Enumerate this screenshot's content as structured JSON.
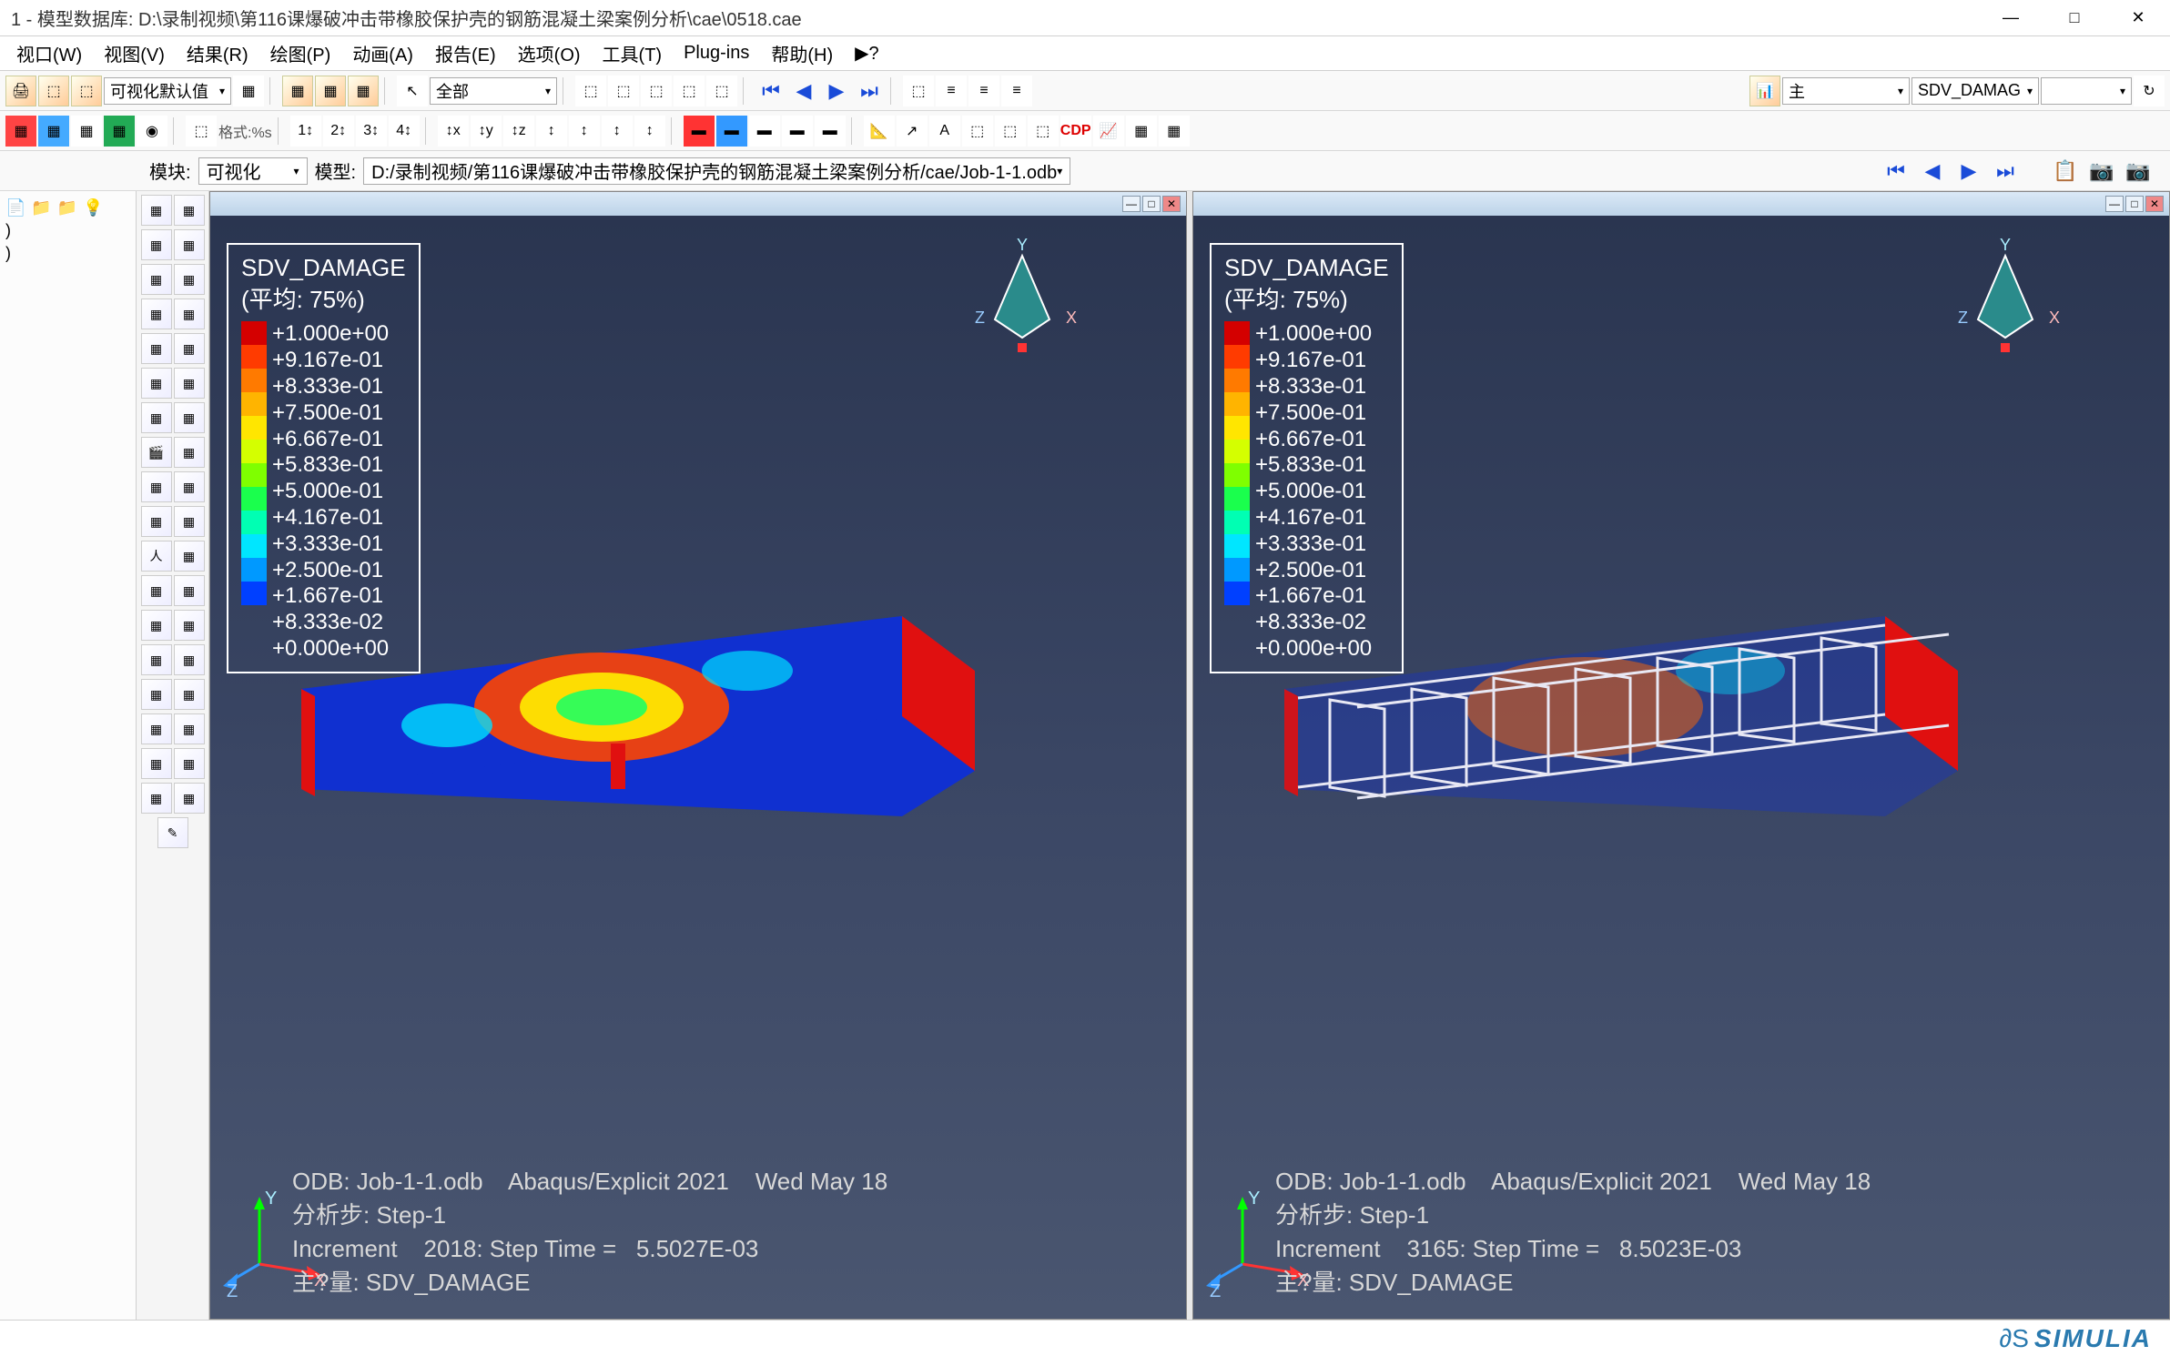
{
  "window": {
    "title": "1 - 模型数据库: D:\\录制视频\\第116课爆破冲击带橡胶保护壳的钢筋混凝土梁案例分析\\cae\\0518.cae"
  },
  "menus": [
    "视口(W)",
    "视图(V)",
    "结果(R)",
    "绘图(P)",
    "动画(A)",
    "报告(E)",
    "选项(O)",
    "工具(T)",
    "Plug-ins",
    "帮助(H)",
    "▶?"
  ],
  "toolbar1": {
    "combo_vis": "可视化默认值",
    "combo_all": "全部",
    "combo_primary": "主",
    "combo_field": "SDV_DAMAG",
    "format_label": "格式:%s"
  },
  "context": {
    "module_label": "模块:",
    "module_value": "可视化",
    "model_label": "模型:",
    "model_value": "D:/录制视频/第116课爆破冲击带橡胶保护壳的钢筋混凝土梁案例分析/cae/Job-1-1.odb"
  },
  "legend": {
    "title": "SDV_DAMAGE",
    "subtitle": "(平均: 75%)",
    "values": [
      "+1.000e+00",
      "+9.167e-01",
      "+8.333e-01",
      "+7.500e-01",
      "+6.667e-01",
      "+5.833e-01",
      "+5.000e-01",
      "+4.167e-01",
      "+3.333e-01",
      "+2.500e-01",
      "+1.667e-01",
      "+8.333e-02",
      "+0.000e+00"
    ],
    "colors": [
      "#d40000",
      "#ff3b00",
      "#ff7a00",
      "#ffb400",
      "#ffe600",
      "#d4ff00",
      "#7fff00",
      "#1aff4d",
      "#00ffb3",
      "#00e6ff",
      "#0099ff",
      "#0040ff"
    ]
  },
  "viewport_left": {
    "line1": "ODB: Job-1-1.odb    Abaqus/Explicit 2021    Wed May 18",
    "line2": "分析步: Step-1",
    "line3": "Increment    2018: Step Time =   5.5027E-03",
    "line4": "主?量: SDV_DAMAGE"
  },
  "viewport_right": {
    "line1": "ODB: Job-1-1.odb    Abaqus/Explicit 2021    Wed May 18",
    "line2": "分析步: Step-1",
    "line3": "Increment    3165: Step Time =   8.5023E-03",
    "line4": "主?量: SDV_DAMAGE"
  },
  "triad": {
    "x": "X",
    "y": "Y",
    "z": "Z"
  },
  "branding": "SIMULIA"
}
